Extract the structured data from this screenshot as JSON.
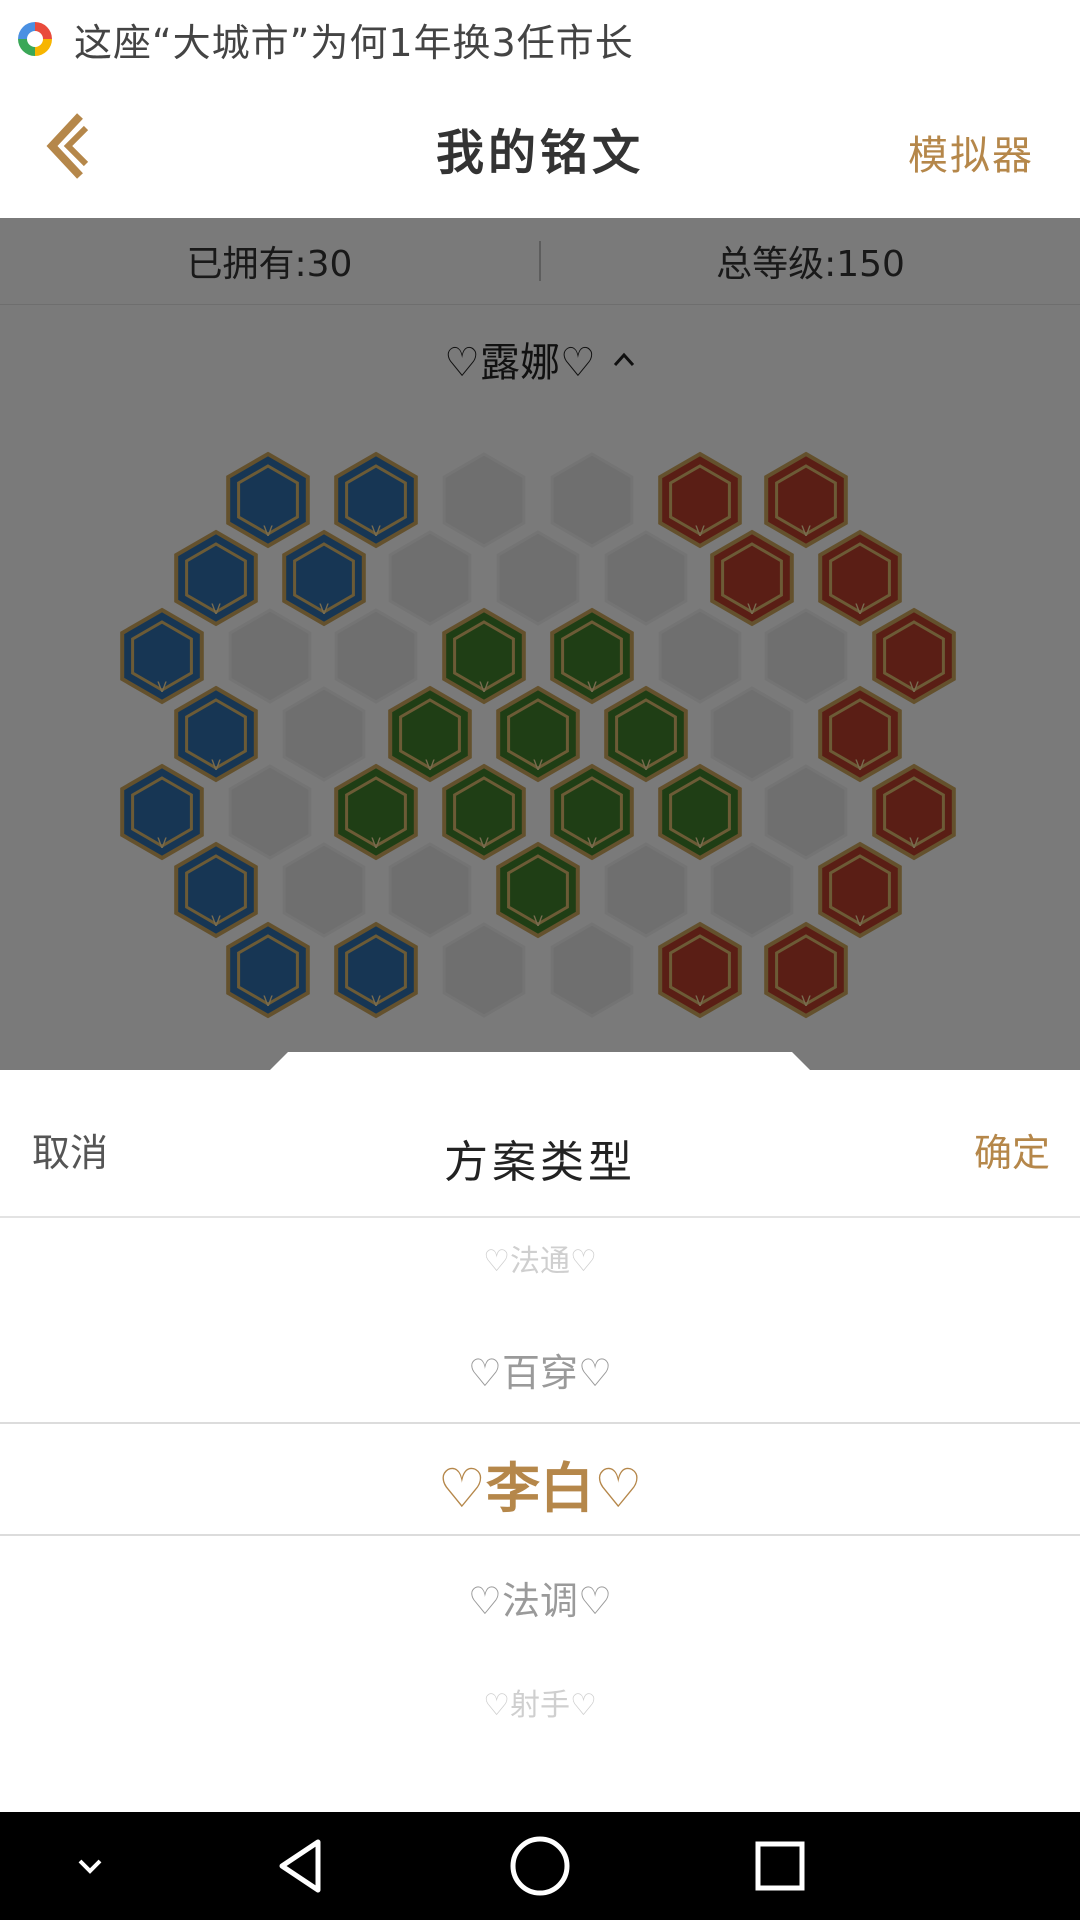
{
  "notification": {
    "icon": "news-app-icon",
    "text": "这座“大城市”为何1年换3任市长"
  },
  "header": {
    "title": "我的铭文",
    "simulator_label": "模拟器",
    "accent": "#b5874a"
  },
  "stats": {
    "owned": "已拥有:30",
    "total_level": "总等级:150"
  },
  "hero_selector": {
    "label": "♡露娜♡"
  },
  "board": {
    "colors": {
      "blue": "#2f6da8",
      "green": "#3f7d2a",
      "red": "#b43d2a",
      "empty": "#dedede"
    }
  },
  "picker": {
    "cancel_label": "取消",
    "title": "方案类型",
    "confirm_label": "确定",
    "options": [
      "♡法通♡",
      "♡百穿♡",
      "♡李白♡",
      "♡法调♡",
      "♡射手♡"
    ],
    "selected": "♡李白♡"
  },
  "navbar": {
    "icons": [
      "chevron-down-icon",
      "back-triangle-icon",
      "home-circle-icon",
      "recents-square-icon"
    ]
  }
}
